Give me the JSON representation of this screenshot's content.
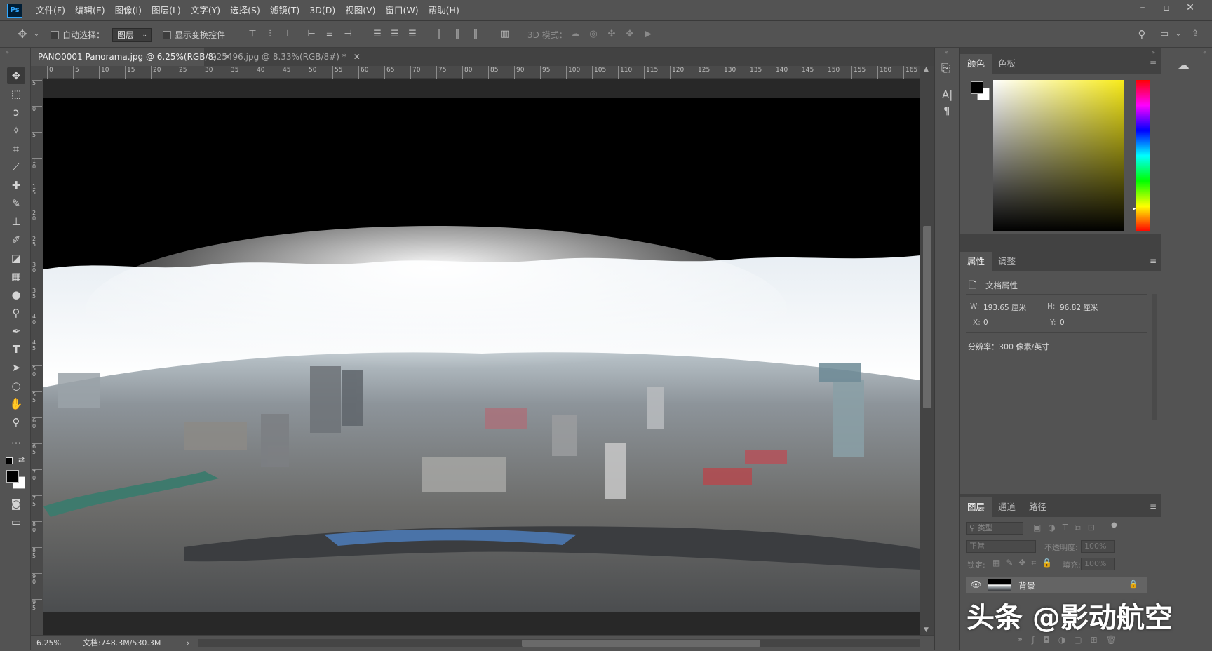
{
  "menubar": {
    "app_icon": "Ps",
    "items": [
      "文件(F)",
      "编辑(E)",
      "图像(I)",
      "图层(L)",
      "文字(Y)",
      "选择(S)",
      "滤镜(T)",
      "3D(D)",
      "视图(V)",
      "窗口(W)",
      "帮助(H)"
    ],
    "window_controls": [
      "–",
      "▫",
      "✕"
    ]
  },
  "options": {
    "auto_select_label": "自动选择：",
    "auto_select_value": "图层",
    "show_transform_label": "显示变换控件",
    "mode_3d_label": "3D 模式："
  },
  "tabs": [
    {
      "label": "PANO0001 Panorama.jpg @ 6.25%(RGB/8)",
      "close": "✕"
    },
    {
      "label": "225496.jpg @ 8.33%(RGB/8#) *",
      "close": "✕"
    }
  ],
  "ruler": {
    "h_ticks": [
      "0",
      "5",
      "10",
      "15",
      "20",
      "25",
      "30",
      "35",
      "40",
      "45",
      "50",
      "55",
      "60",
      "65",
      "70",
      "75",
      "80",
      "85",
      "90",
      "95",
      "100",
      "105",
      "110",
      "115",
      "120",
      "125",
      "130",
      "135",
      "140",
      "145",
      "150",
      "155",
      "160",
      "165"
    ],
    "v_ticks": [
      "5",
      "0",
      "5",
      "1\n0",
      "1\n5",
      "2\n0",
      "2\n5",
      "3\n0",
      "3\n5",
      "4\n0",
      "4\n5",
      "5\n0",
      "5\n5",
      "6\n0",
      "6\n5",
      "7\n0",
      "7\n5",
      "8\n0",
      "8\n5",
      "9\n0",
      "9\n5"
    ]
  },
  "status": {
    "zoom": "6.25%",
    "doc_info": "文档:748.3M/530.3M",
    "arrow": "›"
  },
  "color_panel": {
    "tabs": [
      "颜色",
      "色板"
    ]
  },
  "properties_panel": {
    "tabs": [
      "属性",
      "调整"
    ],
    "title": "文档属性",
    "w_label": "W:",
    "w_value": "193.65 厘米",
    "h_label": "H:",
    "h_value": "96.82 厘米",
    "x_label": "X:",
    "x_value": "0",
    "y_label": "Y:",
    "y_value": "0",
    "resolution": "分辨率：300 像素/英寸"
  },
  "layers_panel": {
    "tabs": [
      "图层",
      "通道",
      "路径"
    ],
    "filter_placeholder": "类型",
    "blend_mode": "正常",
    "opacity_label": "不透明度:",
    "opacity_value": "100%",
    "lock_label": "锁定:",
    "fill_label": "填充:",
    "fill_value": "100%",
    "layers": [
      {
        "name": "背景"
      }
    ]
  },
  "watermark": "头条 @影动航空",
  "colors": {
    "accent": "#31a8ff",
    "panel": "#535353",
    "dark": "#424242"
  }
}
